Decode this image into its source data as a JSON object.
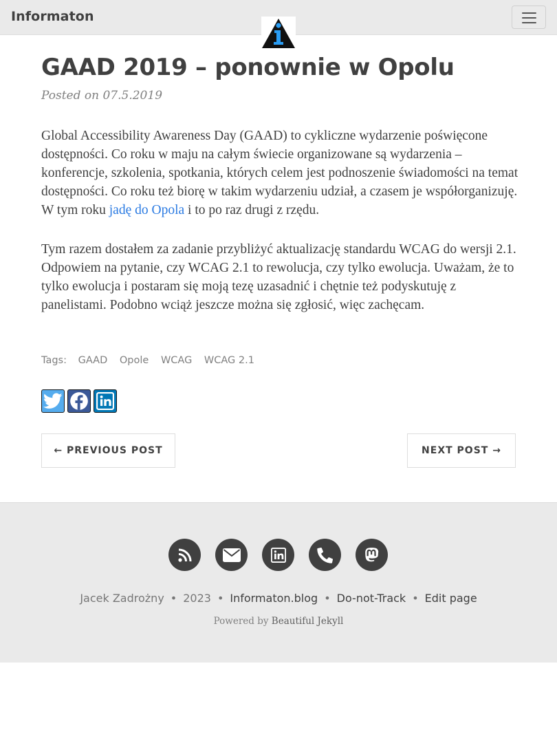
{
  "navbar": {
    "brand": "Informaton",
    "menu_icon": "hamburger-menu-icon"
  },
  "post": {
    "title": "GAAD 2019 – ponownie w Opolu",
    "meta_prefix": "Posted on",
    "date": "07.5.2019",
    "paragraph1_part1": "Global Accessibility Awareness Day (GAAD) to cykliczne wydarzenie poświęcone dostępności. Co roku w maju na całym świecie organizowane są wydarzenia – konferencje, szkolenia, spotkania, których celem jest podnoszenie świadomości na temat dostępności. Co roku też biorę w takim wydarzeniu udział, a czasem je współorganizuję. W tym roku ",
    "paragraph1_link": "jadę do Opola",
    "paragraph1_part2": " i to po raz drugi z rzędu.",
    "paragraph2": "Tym razem dostałem za zadanie przybliżyć aktualizację standardu WCAG do wersji 2.1. Odpowiem na pytanie, czy WCAG 2.1 to rewolucja, czy tylko ewolucja. Uważam, że to tylko ewolucja i postaram się moją tezę uzasadnić i chętnie też podyskutuję z panelistami. Podobno wciąż jeszcze można się zgłosić, więc zachęcam."
  },
  "tags": {
    "label": "Tags:",
    "items": [
      "GAAD",
      "Opole",
      "WCAG",
      "WCAG 2.1"
    ]
  },
  "share": {
    "icons": [
      "twitter-icon",
      "facebook-icon",
      "linkedin-icon"
    ],
    "colors": {
      "twitter": "#55acee",
      "facebook": "#3b5998",
      "linkedin": "#0077b5"
    }
  },
  "pager": {
    "previous": "← PREVIOUS POST",
    "next": "NEXT POST →"
  },
  "footer": {
    "social_icons": [
      "rss-icon",
      "email-icon",
      "linkedin-icon",
      "phone-icon",
      "mastodon-icon"
    ],
    "author": "Jacek Zadrożny",
    "year": "2023",
    "site": "Informaton.blog",
    "dnt": "Do-not-Track",
    "edit": "Edit page",
    "powered_prefix": "Powered by",
    "powered_link": "Beautiful Jekyll"
  },
  "colors": {
    "navbar_bg": "#eaeaea",
    "link": "#2a7ae2",
    "text": "#404040",
    "footer_bg": "#eaeaea"
  }
}
